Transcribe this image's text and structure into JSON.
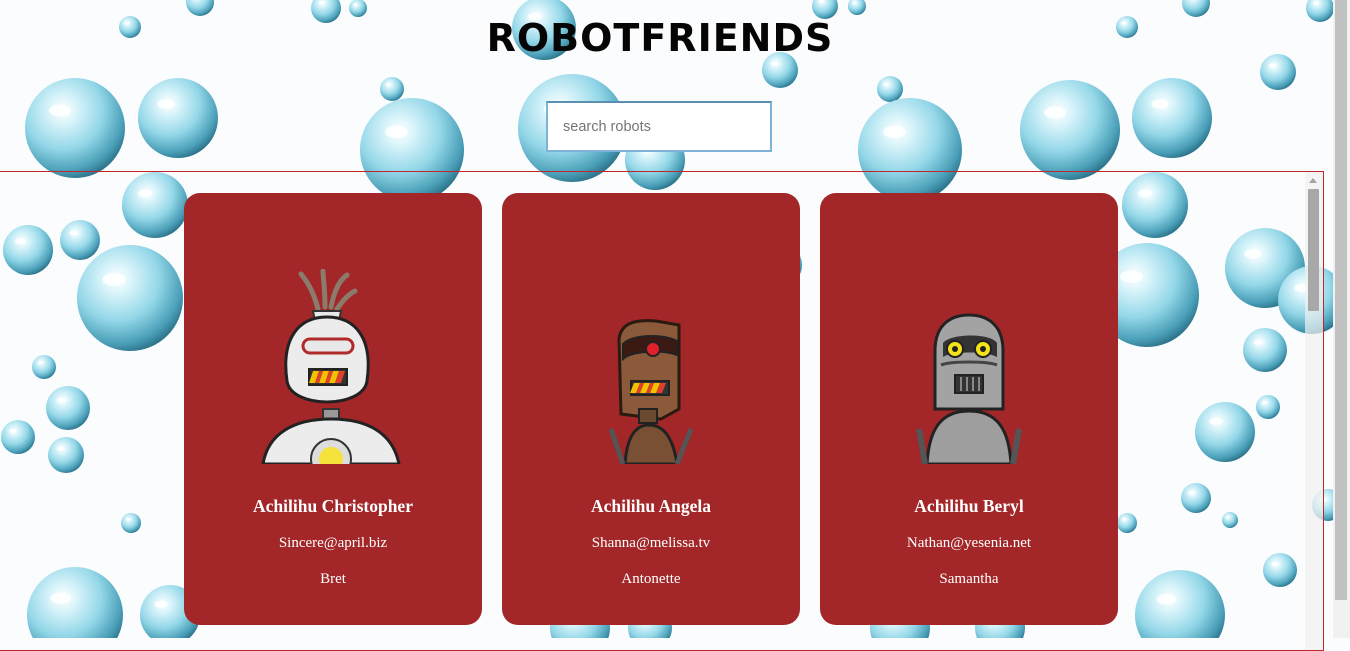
{
  "header": {
    "title": "ROBOTFRIENDS"
  },
  "search": {
    "placeholder": "search robots",
    "value": ""
  },
  "robots": [
    {
      "name": "Achilihu Christopher",
      "email": "Sincere@april.biz",
      "username": "Bret",
      "avatar_icon": "white-robot-icon"
    },
    {
      "name": "Achilihu Angela",
      "email": "Shanna@melissa.tv",
      "username": "Antonette",
      "avatar_icon": "brown-robot-icon"
    },
    {
      "name": "Achilihu Beryl",
      "email": "Nathan@yesenia.net",
      "username": "Samantha",
      "avatar_icon": "silver-robot-icon"
    }
  ],
  "colors": {
    "card": "#a32628",
    "border": "#c0272d",
    "search_border": "#7fb3d5",
    "bubble": "#9fdcec"
  }
}
